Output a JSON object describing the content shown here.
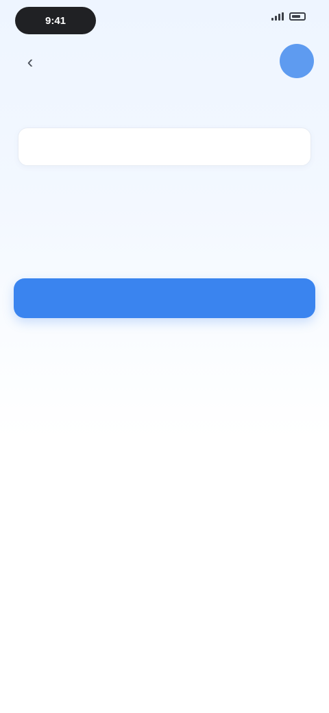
{
  "status_bar": {
    "time": "9:41"
  },
  "header": {
    "back_icon": "chevron-left-icon",
    "title": "",
    "avatar_initial": "",
    "subtitle_prefix": "",
    "subtitle_link": ""
  },
  "form": {
    "input_placeholder": "",
    "section_label": "",
    "options": [
      "",
      "",
      "",
      "",
      ""
    ],
    "selected_index": 1
  },
  "actions": {
    "primary_label": "",
    "footnote": ""
  },
  "colors": {
    "accent": "#3a84ef",
    "avatar": "#5e9bf0",
    "background_top": "#eef5ff"
  }
}
